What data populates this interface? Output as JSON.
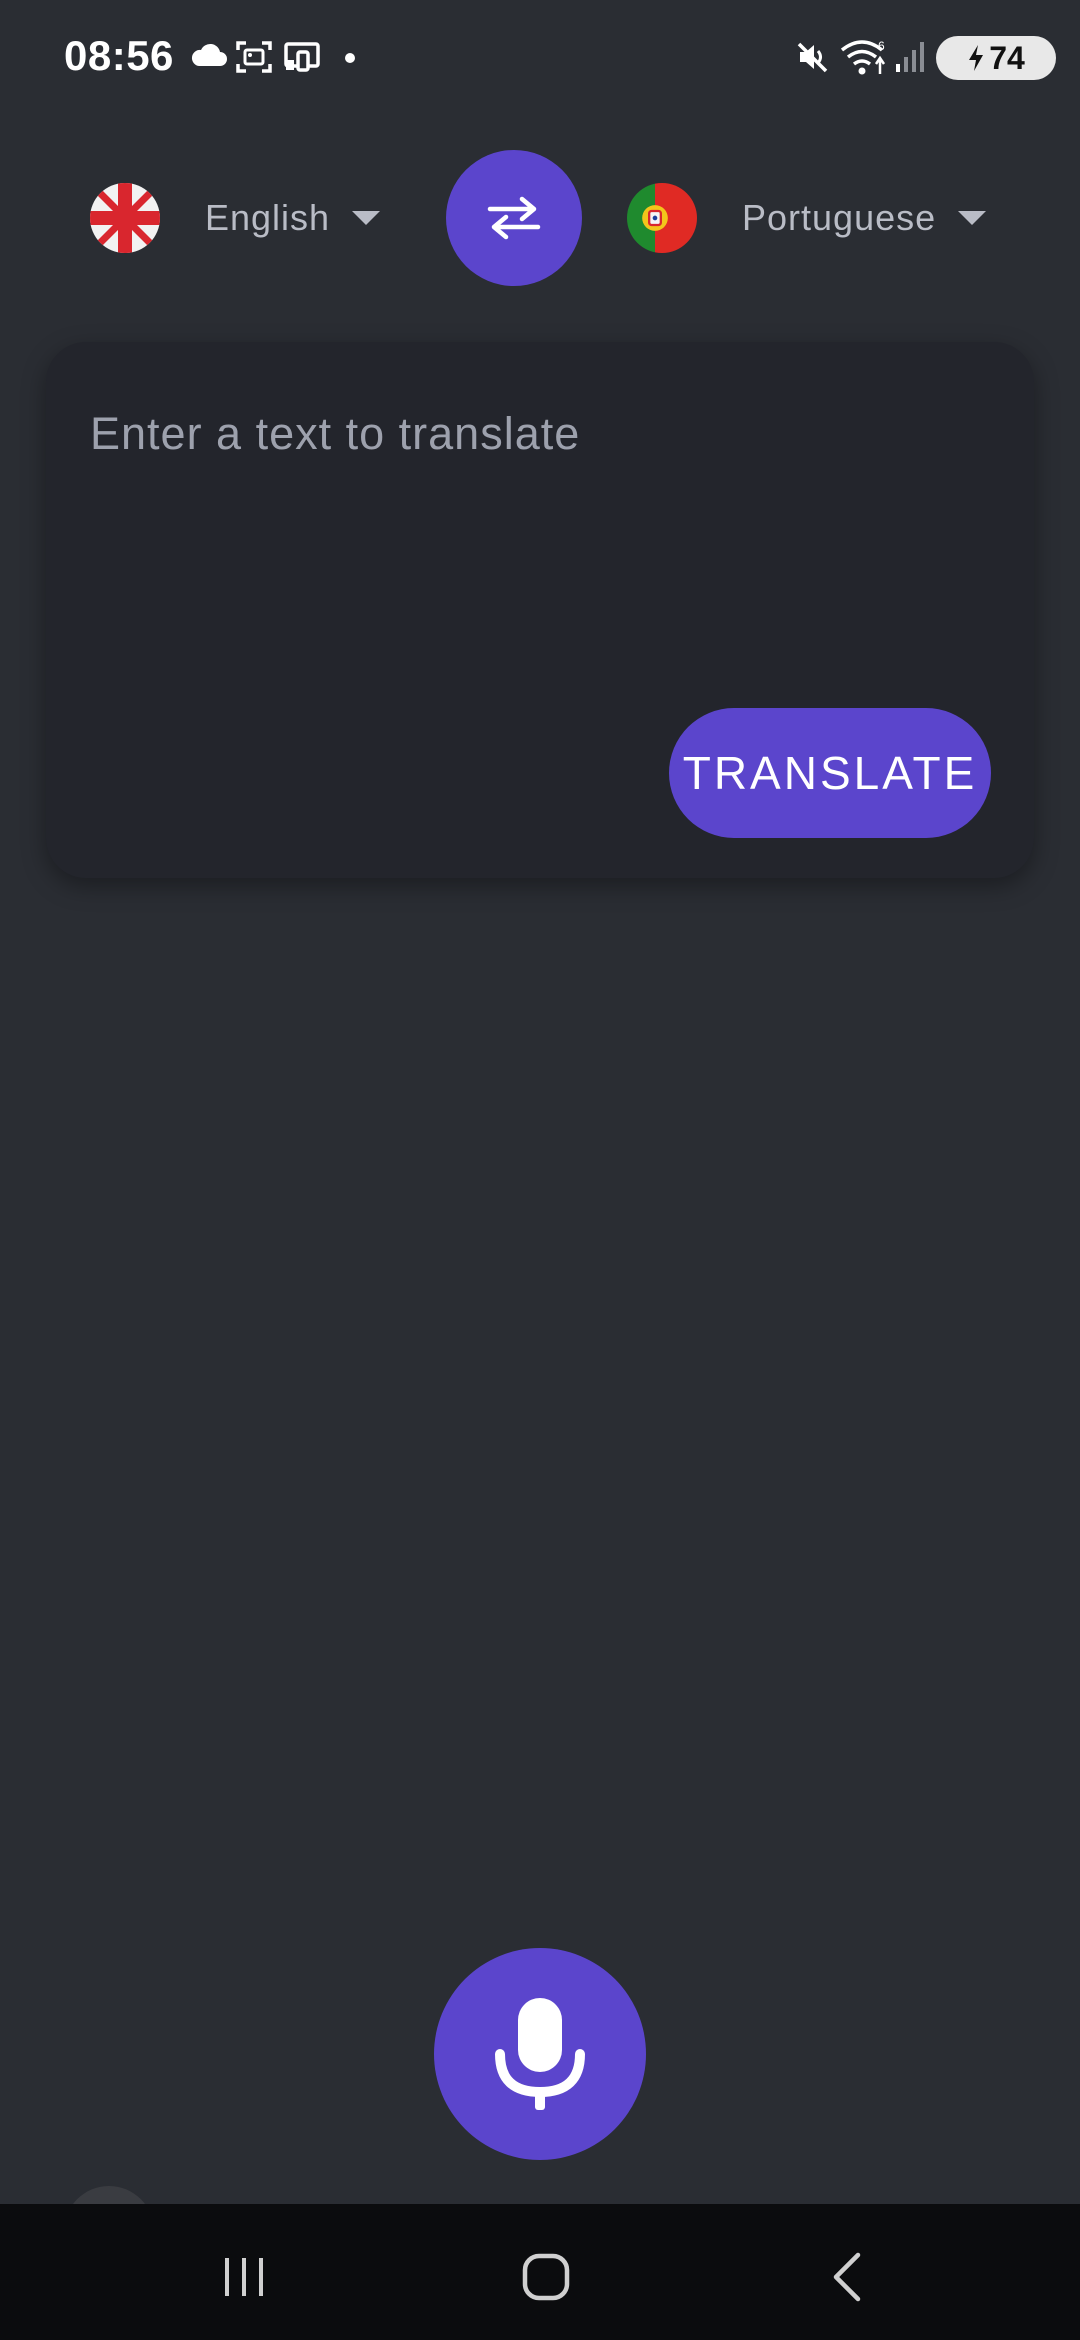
{
  "status_bar": {
    "time": "08:56",
    "battery_level": "74",
    "icons": [
      "cloud-icon",
      "screenshot-icon",
      "cast-icon",
      "notification-dot-icon",
      "mute-icon",
      "wifi-icon",
      "signal-icon",
      "charging-icon"
    ]
  },
  "languages": {
    "source": {
      "label": "English",
      "flag": "uk-flag-icon"
    },
    "target": {
      "label": "Portuguese",
      "flag": "portugal-flag-icon"
    },
    "swap_icon": "swap-arrows-icon"
  },
  "input": {
    "placeholder": "Enter a text to translate",
    "value": ""
  },
  "translate_button": {
    "label": "TRANSLATE"
  },
  "mic_icon": "microphone-icon",
  "navigation": [
    "recents-icon",
    "home-icon",
    "back-icon"
  ],
  "colors": {
    "background": "#2a2d33",
    "card": "#23252c",
    "accent": "#5b45cc",
    "label": "#b9bcc6",
    "placeholder": "#9da1ad",
    "nav_bar": "#0b0c0e"
  }
}
